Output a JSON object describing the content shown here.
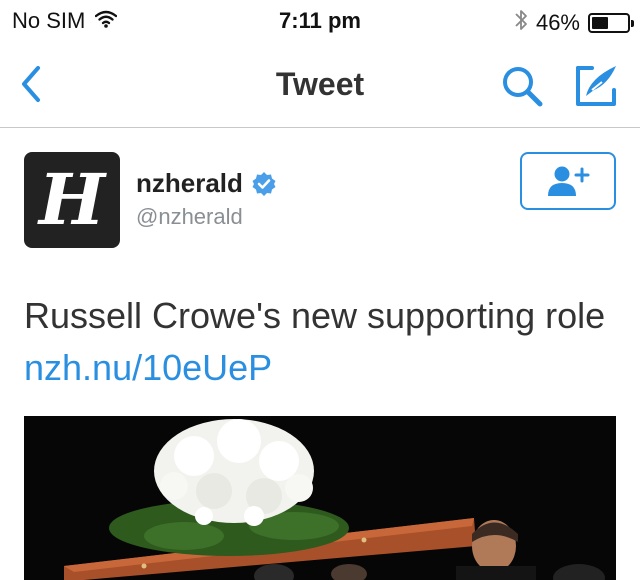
{
  "status_bar": {
    "carrier": "No SIM",
    "time": "7:11 pm",
    "battery_percent": "46%",
    "battery_level": 0.46,
    "icons": [
      "wifi-icon",
      "bluetooth-icon",
      "battery-icon"
    ]
  },
  "nav": {
    "title": "Tweet",
    "back_icon": "chevron-left-icon",
    "search_icon": "search-icon",
    "compose_icon": "compose-icon"
  },
  "tweet": {
    "author": {
      "name": "nzherald",
      "handle": "@nzherald",
      "verified": true,
      "avatar_letter": "H"
    },
    "follow_icon": "add-user-icon",
    "text_prefix": "Russell Crowe's new supporting role ",
    "link_text": "nzh.nu/10eUeP",
    "media": {
      "kind": "photo",
      "description_icon": "photo-icon"
    }
  },
  "colors": {
    "accent": "#2a8fe0",
    "text": "#333333",
    "secondary": "#8a8f94",
    "avatar_bg": "#222222"
  }
}
